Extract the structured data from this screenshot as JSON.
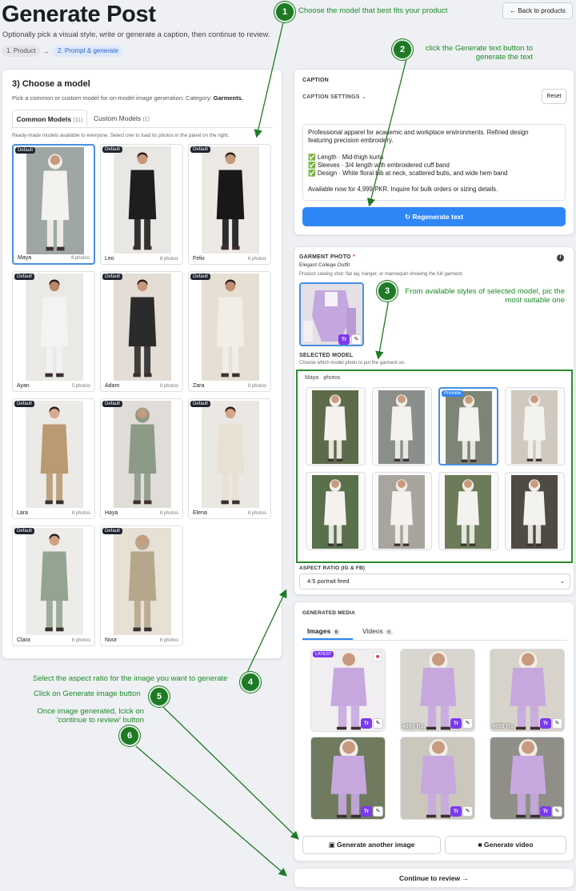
{
  "header": {
    "title": "Generate Post",
    "subtitle": "Optionally pick a visual style, write or generate a caption, then continue to review.",
    "steps": [
      "1. Product",
      "→",
      "2. Prompt & generate"
    ],
    "back_label": "Back to products"
  },
  "model_panel": {
    "heading": "3) Choose a model",
    "description_prefix": "Pick a common or custom model for on-model image generation. Category: ",
    "category": "Garments.",
    "tabs": [
      {
        "label": "Common Models",
        "count": "(11)"
      },
      {
        "label": "Custom Models",
        "count": "(1)"
      }
    ],
    "hint": "Ready-made models available to everyone. Select one to load its photos in the panel on the right.",
    "badge": "Default",
    "models": [
      {
        "name": "Maya",
        "photos": "8 photos",
        "skin": "#c89a7e",
        "outfit": "#f4f2ee",
        "bg": "#9ea7a4"
      },
      {
        "name": "Leo",
        "photos": "8 photos",
        "skin": "#c99878",
        "outfit": "#1e1e1e",
        "bg": "#e9e7e4"
      },
      {
        "name": "Felix",
        "photos": "6 photos",
        "skin": "#c79a7a",
        "outfit": "#181818",
        "bg": "#ece9e4"
      },
      {
        "name": "Ayan",
        "photos": "5 photos",
        "skin": "#b98667",
        "outfit": "#f3f3f3",
        "bg": "#ebe9e6"
      },
      {
        "name": "Adam",
        "photos": "8 photos",
        "skin": "#c8977a",
        "outfit": "#2b2b2b",
        "bg": "#e3ddd5"
      },
      {
        "name": "Zara",
        "photos": "8 photos",
        "skin": "#c08e72",
        "outfit": "#f1eee6",
        "bg": "#e6dfd4"
      },
      {
        "name": "Lara",
        "photos": "8 photos",
        "skin": "#d9aa8f",
        "outfit": "#b99a72",
        "bg": "#eceae7"
      },
      {
        "name": "Haya",
        "photos": "6 photos",
        "skin": "#c49a80",
        "outfit": "#8c9a86",
        "bg": "#e0ddd8"
      },
      {
        "name": "Elena",
        "photos": "6 photos",
        "skin": "#d4a58b",
        "outfit": "#e8e0d2",
        "bg": "#ebe8e3"
      },
      {
        "name": "Clara",
        "photos": "6 photos",
        "skin": "#d1a286",
        "outfit": "#93a592",
        "bg": "#eeece8"
      },
      {
        "name": "Noor",
        "photos": "6 photos",
        "skin": "#c89c80",
        "outfit": "#b5a78c",
        "bg": "#e6e0d5"
      }
    ]
  },
  "caption": {
    "label": "CAPTION",
    "settings_label": "CAPTION SETTINGS",
    "reset_label": "Reset",
    "lines": [
      "Professional apparel for academic and workplace environments. Refined design",
      "featuring precision embroidery.",
      "",
      "✅ Length · Mid-thigh kurta",
      "✅ Sleeves · 3/4 length with embroidered cuff band",
      "✅ Design · White floral bib at neck, scattered butis, and wide hem band",
      "",
      "Available now for 4,999 PKR. Inquire for bulk orders or sizing details."
    ],
    "regenerate_label": "Regenerate text"
  },
  "garment": {
    "label": "GARMENT PHOTO",
    "required": "*",
    "name": "Elegant College Outfit",
    "hint": "Product catalog shot: flat lay, hanger, or mannequin showing the full garment.",
    "selected_label": "SELECTED MODEL",
    "selected_hint": "Choose which model photo to put the garment on.",
    "gallery_title": "Maya · photos",
    "preview_badge": "Preview",
    "aspect_label": "ASPECT RATIO (IG & FB)",
    "aspect_value": "4:5 portrait feed",
    "tr": "Tr"
  },
  "media": {
    "label": "GENERATED MEDIA",
    "tabs": [
      {
        "label": "Images",
        "count": "6"
      },
      {
        "label": "Videos",
        "count": "6"
      }
    ],
    "latest": "LATEST",
    "price": "4999 Rs.",
    "generate_image_label": "Generate another image",
    "generate_video_label": "Generate video",
    "continue_label": "Continue to review"
  },
  "annotations": [
    {
      "num": "1",
      "text": "Choose the model that best fits your product"
    },
    {
      "num": "2",
      "text": "click the Generate text button to generate the text"
    },
    {
      "num": "3",
      "text": "From available styles of selected model, pic the most suitable one"
    },
    {
      "num": "4",
      "text": "Select the aspect ratio for the image you want to generate"
    },
    {
      "num": "5",
      "text": "Click on Generate image button"
    },
    {
      "num": "6",
      "text": "Once image generated, lcick on 'continue to review' button"
    }
  ],
  "colors": {
    "accent": "#2f86f6",
    "annotation": "#1e8a2a",
    "tr_badge": "#7c3aed",
    "selected_border": "#4a90e2"
  }
}
